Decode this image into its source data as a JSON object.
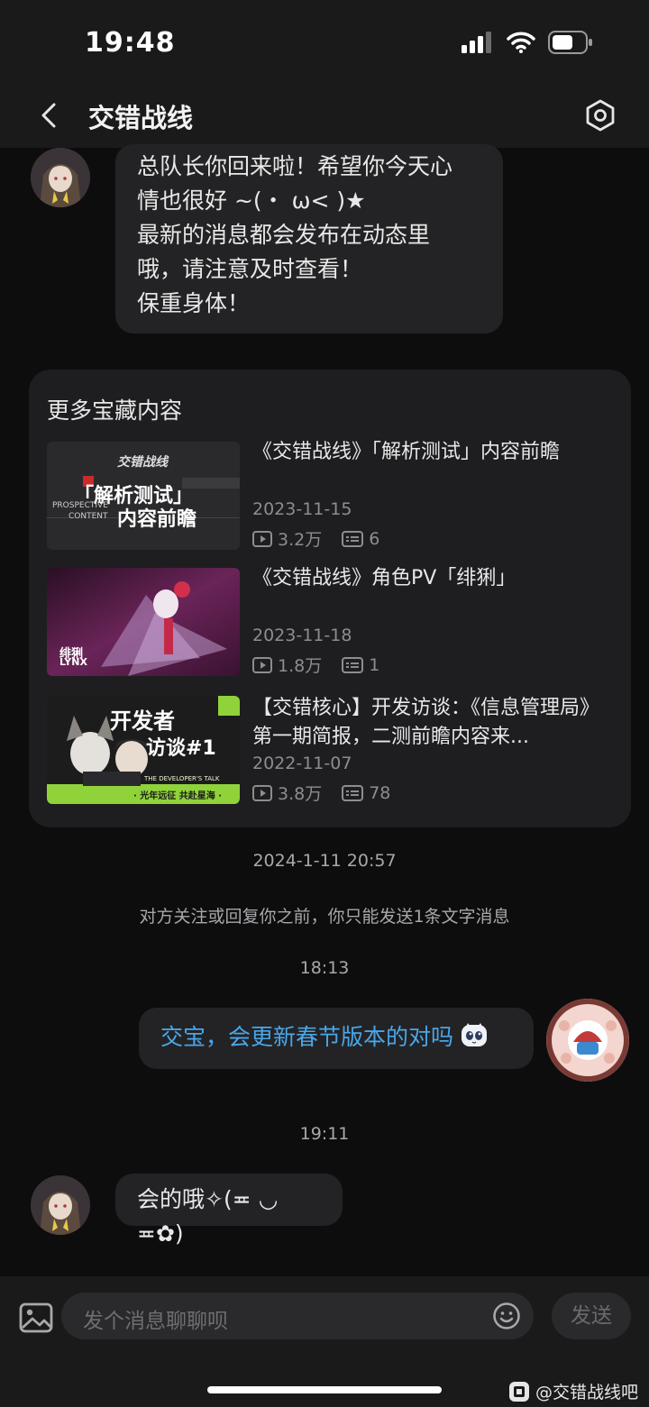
{
  "status": {
    "time": "19:48"
  },
  "header": {
    "title": "交错战线"
  },
  "messages": {
    "greeting": [
      "总队长你回来啦！希望你今天心",
      "情也很好 ~(・ ω< )★",
      "最新的消息都会发布在动态里",
      "哦，请注意及时查看！",
      "保重身体！"
    ],
    "reply_text": "会的哦✧(≖ ◡ ≖✿)"
  },
  "more": {
    "title": "更多宝藏内容",
    "videos": [
      {
        "title": "《交错战线》「解析测试」内容前瞻",
        "date": "2023-11-15",
        "plays": "3.2万",
        "comments": "6",
        "thumb_big": "「解析测试」",
        "thumb_big2": "内容前瞻",
        "thumb_small": "PROSPECTIVE",
        "thumb_small2": "CONTENT",
        "thumb_logo": "交错战线"
      },
      {
        "title": "《交错战线》角色PV「绯猁」",
        "date": "2023-11-18",
        "plays": "1.8万",
        "comments": "1",
        "thumb_name": "绯猁",
        "thumb_en": "LYNX"
      },
      {
        "title": "【交错核心】开发访谈：《信息管理局》第一期简报，二测前瞻内容来...",
        "date": "2022-11-07",
        "plays": "3.8万",
        "comments": "78",
        "thumb_big": "开发者",
        "thumb_big2": "访谈#1",
        "thumb_en": "THE DEVELOPER'S TALK",
        "thumb_slogan": "· 光年远征 共赴星海 ·"
      }
    ]
  },
  "timestamp1": "2024-1-11 20:57",
  "notice": "对方关注或回复你之前，你只能发送1条文字消息",
  "timestamp2": "18:13",
  "outgoing": "交宝，会更新春节版本的对吗",
  "timestamp3": "19:11",
  "input": {
    "placeholder": "发个消息聊聊呗",
    "send_label": "发送"
  },
  "watermark": "@交错战线吧",
  "colors": {
    "accent_blue": "#4aa6e8",
    "bg": "#0d0d0e",
    "bubble": "#232325"
  }
}
